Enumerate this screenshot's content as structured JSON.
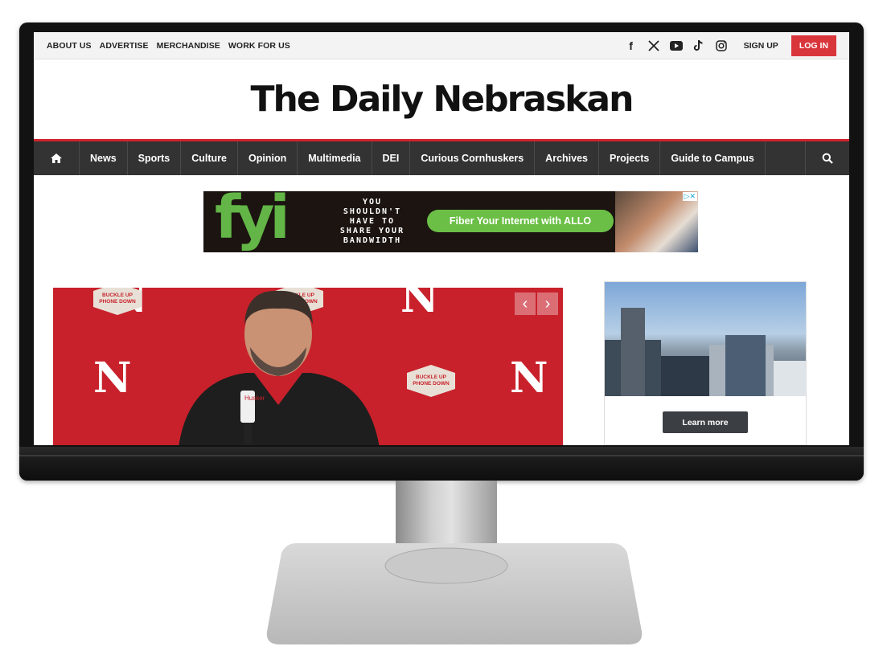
{
  "utility_bar": {
    "links": [
      "ABOUT US",
      "ADVERTISE",
      "MERCHANDISE",
      "WORK FOR US"
    ],
    "social_icons": [
      "facebook-icon",
      "x-icon",
      "youtube-icon",
      "tiktok-icon",
      "instagram-icon"
    ],
    "signup_label": "SIGN UP",
    "login_label": "LOG IN"
  },
  "masthead": {
    "title": "The Daily Nebraskan"
  },
  "nav": {
    "items": [
      "News",
      "Sports",
      "Culture",
      "Opinion",
      "Multimedia",
      "DEI",
      "Curious Cornhuskers",
      "Archives",
      "Projects",
      "Guide to Campus"
    ]
  },
  "ad_banner": {
    "brand": "fyi",
    "tagline": "YOU\nSHOULDN'T\nHAVE TO\nSHARE YOUR\nBANDWIDTH",
    "cta": "Fiber Your Internet with ALLO",
    "ad_choices": "▷✕"
  },
  "hero": {
    "backdrop_letter": "N",
    "badge_text": "BUCKLE UP\nPHONE DOWN"
  },
  "side_ad": {
    "button_label": "Learn more"
  },
  "colors": {
    "accent_red": "#d3242c",
    "nav_bg": "#333333",
    "ad_green": "#62b546"
  }
}
